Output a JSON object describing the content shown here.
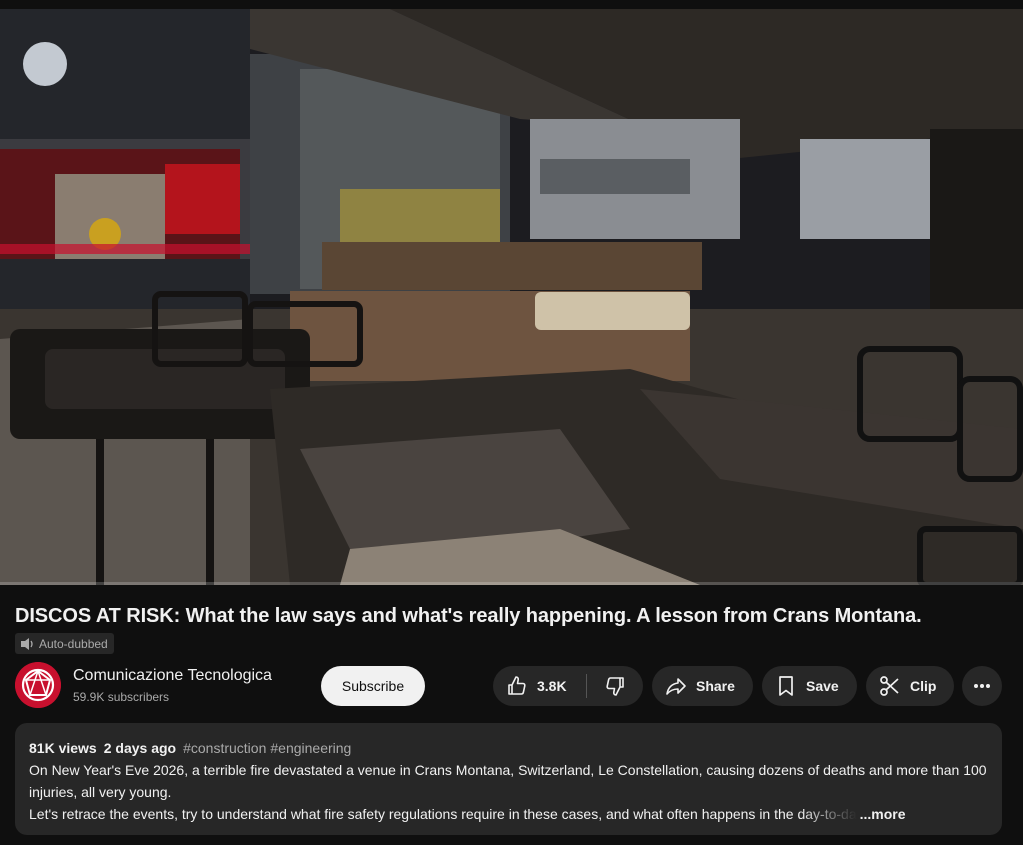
{
  "video": {
    "title": "DISCOS AT RISK: What the law says and what's really happening. A lesson from Crans Montana.",
    "dub_badge": "Auto-dubbed"
  },
  "channel": {
    "name": "Comunicazione Tecnologica",
    "subscribers": "59.9K subscribers",
    "subscribe_label": "Subscribe",
    "avatar_color": "#c8102e"
  },
  "actions": {
    "likes": "3.8K",
    "share_label": "Share",
    "save_label": "Save",
    "clip_label": "Clip"
  },
  "description": {
    "views": "81K views",
    "date": "2 days ago",
    "tags": [
      "#construction",
      "#engineering"
    ],
    "line1": "On New Year's Eve 2026, a terrible fire devastated a venue in Crans Montana, Switzerland, Le Constellation, causing dozens of deaths and more than 100 injuries, all very young.",
    "line3": "Let's retrace the events, try to understand what fire safety regulations require in these cases, and what often happens in the day-to-da",
    "more_label": "...more"
  },
  "icons": {
    "dub": "dub-icon",
    "like": "thumbs-up-icon",
    "dislike": "thumbs-down-icon",
    "share": "share-icon",
    "save": "bookmark-icon",
    "clip": "scissors-icon",
    "more": "more-horizontal-icon"
  }
}
